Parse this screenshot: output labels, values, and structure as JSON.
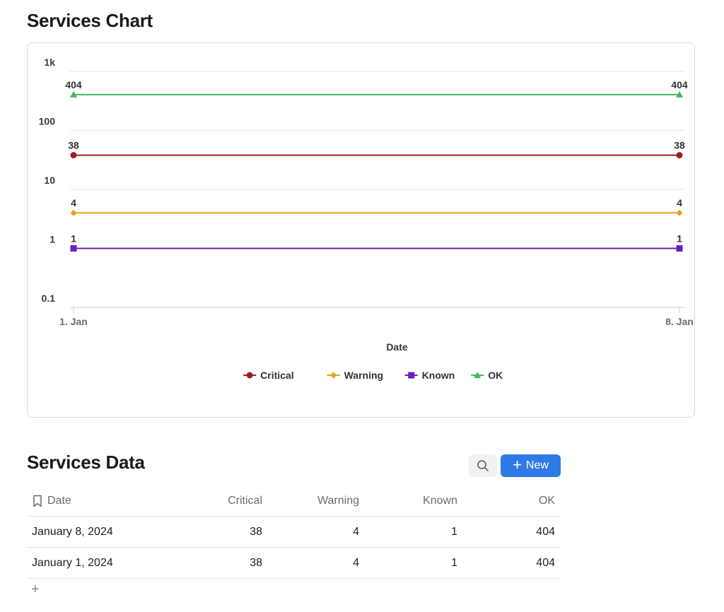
{
  "chart_section": {
    "title": "Services Chart"
  },
  "chart_data": {
    "type": "line",
    "x": [
      "1. Jan",
      "8. Jan"
    ],
    "xlabel": "Date",
    "ylabel": "",
    "yscale": "log",
    "ylim": [
      0.1,
      1000
    ],
    "yticks": [
      "0.1",
      "1",
      "10",
      "100",
      "1k"
    ],
    "legend_position": "bottom",
    "series": [
      {
        "name": "Critical",
        "values": [
          38,
          38
        ],
        "color": "#a11d1d",
        "marker": "circle"
      },
      {
        "name": "Warning",
        "values": [
          4,
          4
        ],
        "color": "#e6a31a",
        "marker": "diamond"
      },
      {
        "name": "Known",
        "values": [
          1,
          1
        ],
        "color": "#6a1fbf",
        "marker": "square"
      },
      {
        "name": "OK",
        "values": [
          404,
          404
        ],
        "color": "#3dbb5a",
        "marker": "triangle"
      }
    ],
    "data_labels": true
  },
  "data_section": {
    "title": "Services Data",
    "search_icon": "search-icon",
    "new_label": "New",
    "add_icon": "+",
    "columns": [
      "Date",
      "Critical",
      "Warning",
      "Known",
      "OK"
    ],
    "rows": [
      {
        "date": "January 8, 2024",
        "critical": "38",
        "warning": "4",
        "known": "1",
        "ok": "404"
      },
      {
        "date": "January 1, 2024",
        "critical": "38",
        "warning": "4",
        "known": "1",
        "ok": "404"
      }
    ]
  },
  "colors": {
    "accent": "#2f7ae5",
    "border": "#dcdcdc"
  }
}
